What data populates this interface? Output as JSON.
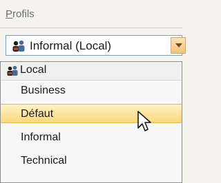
{
  "profiles_group": {
    "label_accesskey": "P",
    "label_rest": "rofils"
  },
  "combo": {
    "selected_value": "Informal (Local)",
    "icon": "users-icon"
  },
  "dropdown": {
    "group_header": "Local",
    "group_icon": "users-icon",
    "items": [
      {
        "label": "Business"
      },
      {
        "label": "Défaut",
        "highlighted": true
      },
      {
        "label": "Informal"
      },
      {
        "label": "Technical"
      }
    ]
  },
  "colors": {
    "highlight": "#fbd97a",
    "icon_people": "#4a6a96",
    "icon_people_dark": "#2b2b2b"
  },
  "cursor": "pointer-arrow-icon"
}
